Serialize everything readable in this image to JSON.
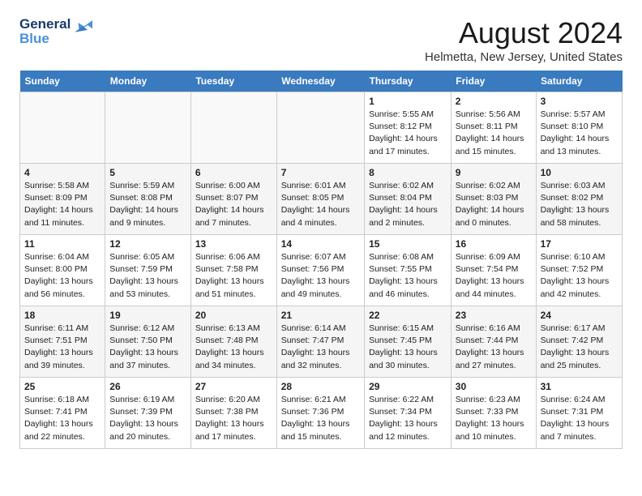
{
  "header": {
    "logo_line1": "General",
    "logo_line2": "Blue",
    "month_year": "August 2024",
    "location": "Helmetta, New Jersey, United States"
  },
  "days_of_week": [
    "Sunday",
    "Monday",
    "Tuesday",
    "Wednesday",
    "Thursday",
    "Friday",
    "Saturday"
  ],
  "weeks": [
    [
      {
        "day": "",
        "info": ""
      },
      {
        "day": "",
        "info": ""
      },
      {
        "day": "",
        "info": ""
      },
      {
        "day": "",
        "info": ""
      },
      {
        "day": "1",
        "info": "Sunrise: 5:55 AM\nSunset: 8:12 PM\nDaylight: 14 hours\nand 17 minutes."
      },
      {
        "day": "2",
        "info": "Sunrise: 5:56 AM\nSunset: 8:11 PM\nDaylight: 14 hours\nand 15 minutes."
      },
      {
        "day": "3",
        "info": "Sunrise: 5:57 AM\nSunset: 8:10 PM\nDaylight: 14 hours\nand 13 minutes."
      }
    ],
    [
      {
        "day": "4",
        "info": "Sunrise: 5:58 AM\nSunset: 8:09 PM\nDaylight: 14 hours\nand 11 minutes."
      },
      {
        "day": "5",
        "info": "Sunrise: 5:59 AM\nSunset: 8:08 PM\nDaylight: 14 hours\nand 9 minutes."
      },
      {
        "day": "6",
        "info": "Sunrise: 6:00 AM\nSunset: 8:07 PM\nDaylight: 14 hours\nand 7 minutes."
      },
      {
        "day": "7",
        "info": "Sunrise: 6:01 AM\nSunset: 8:05 PM\nDaylight: 14 hours\nand 4 minutes."
      },
      {
        "day": "8",
        "info": "Sunrise: 6:02 AM\nSunset: 8:04 PM\nDaylight: 14 hours\nand 2 minutes."
      },
      {
        "day": "9",
        "info": "Sunrise: 6:02 AM\nSunset: 8:03 PM\nDaylight: 14 hours\nand 0 minutes."
      },
      {
        "day": "10",
        "info": "Sunrise: 6:03 AM\nSunset: 8:02 PM\nDaylight: 13 hours\nand 58 minutes."
      }
    ],
    [
      {
        "day": "11",
        "info": "Sunrise: 6:04 AM\nSunset: 8:00 PM\nDaylight: 13 hours\nand 56 minutes."
      },
      {
        "day": "12",
        "info": "Sunrise: 6:05 AM\nSunset: 7:59 PM\nDaylight: 13 hours\nand 53 minutes."
      },
      {
        "day": "13",
        "info": "Sunrise: 6:06 AM\nSunset: 7:58 PM\nDaylight: 13 hours\nand 51 minutes."
      },
      {
        "day": "14",
        "info": "Sunrise: 6:07 AM\nSunset: 7:56 PM\nDaylight: 13 hours\nand 49 minutes."
      },
      {
        "day": "15",
        "info": "Sunrise: 6:08 AM\nSunset: 7:55 PM\nDaylight: 13 hours\nand 46 minutes."
      },
      {
        "day": "16",
        "info": "Sunrise: 6:09 AM\nSunset: 7:54 PM\nDaylight: 13 hours\nand 44 minutes."
      },
      {
        "day": "17",
        "info": "Sunrise: 6:10 AM\nSunset: 7:52 PM\nDaylight: 13 hours\nand 42 minutes."
      }
    ],
    [
      {
        "day": "18",
        "info": "Sunrise: 6:11 AM\nSunset: 7:51 PM\nDaylight: 13 hours\nand 39 minutes."
      },
      {
        "day": "19",
        "info": "Sunrise: 6:12 AM\nSunset: 7:50 PM\nDaylight: 13 hours\nand 37 minutes."
      },
      {
        "day": "20",
        "info": "Sunrise: 6:13 AM\nSunset: 7:48 PM\nDaylight: 13 hours\nand 34 minutes."
      },
      {
        "day": "21",
        "info": "Sunrise: 6:14 AM\nSunset: 7:47 PM\nDaylight: 13 hours\nand 32 minutes."
      },
      {
        "day": "22",
        "info": "Sunrise: 6:15 AM\nSunset: 7:45 PM\nDaylight: 13 hours\nand 30 minutes."
      },
      {
        "day": "23",
        "info": "Sunrise: 6:16 AM\nSunset: 7:44 PM\nDaylight: 13 hours\nand 27 minutes."
      },
      {
        "day": "24",
        "info": "Sunrise: 6:17 AM\nSunset: 7:42 PM\nDaylight: 13 hours\nand 25 minutes."
      }
    ],
    [
      {
        "day": "25",
        "info": "Sunrise: 6:18 AM\nSunset: 7:41 PM\nDaylight: 13 hours\nand 22 minutes."
      },
      {
        "day": "26",
        "info": "Sunrise: 6:19 AM\nSunset: 7:39 PM\nDaylight: 13 hours\nand 20 minutes."
      },
      {
        "day": "27",
        "info": "Sunrise: 6:20 AM\nSunset: 7:38 PM\nDaylight: 13 hours\nand 17 minutes."
      },
      {
        "day": "28",
        "info": "Sunrise: 6:21 AM\nSunset: 7:36 PM\nDaylight: 13 hours\nand 15 minutes."
      },
      {
        "day": "29",
        "info": "Sunrise: 6:22 AM\nSunset: 7:34 PM\nDaylight: 13 hours\nand 12 minutes."
      },
      {
        "day": "30",
        "info": "Sunrise: 6:23 AM\nSunset: 7:33 PM\nDaylight: 13 hours\nand 10 minutes."
      },
      {
        "day": "31",
        "info": "Sunrise: 6:24 AM\nSunset: 7:31 PM\nDaylight: 13 hours\nand 7 minutes."
      }
    ]
  ]
}
